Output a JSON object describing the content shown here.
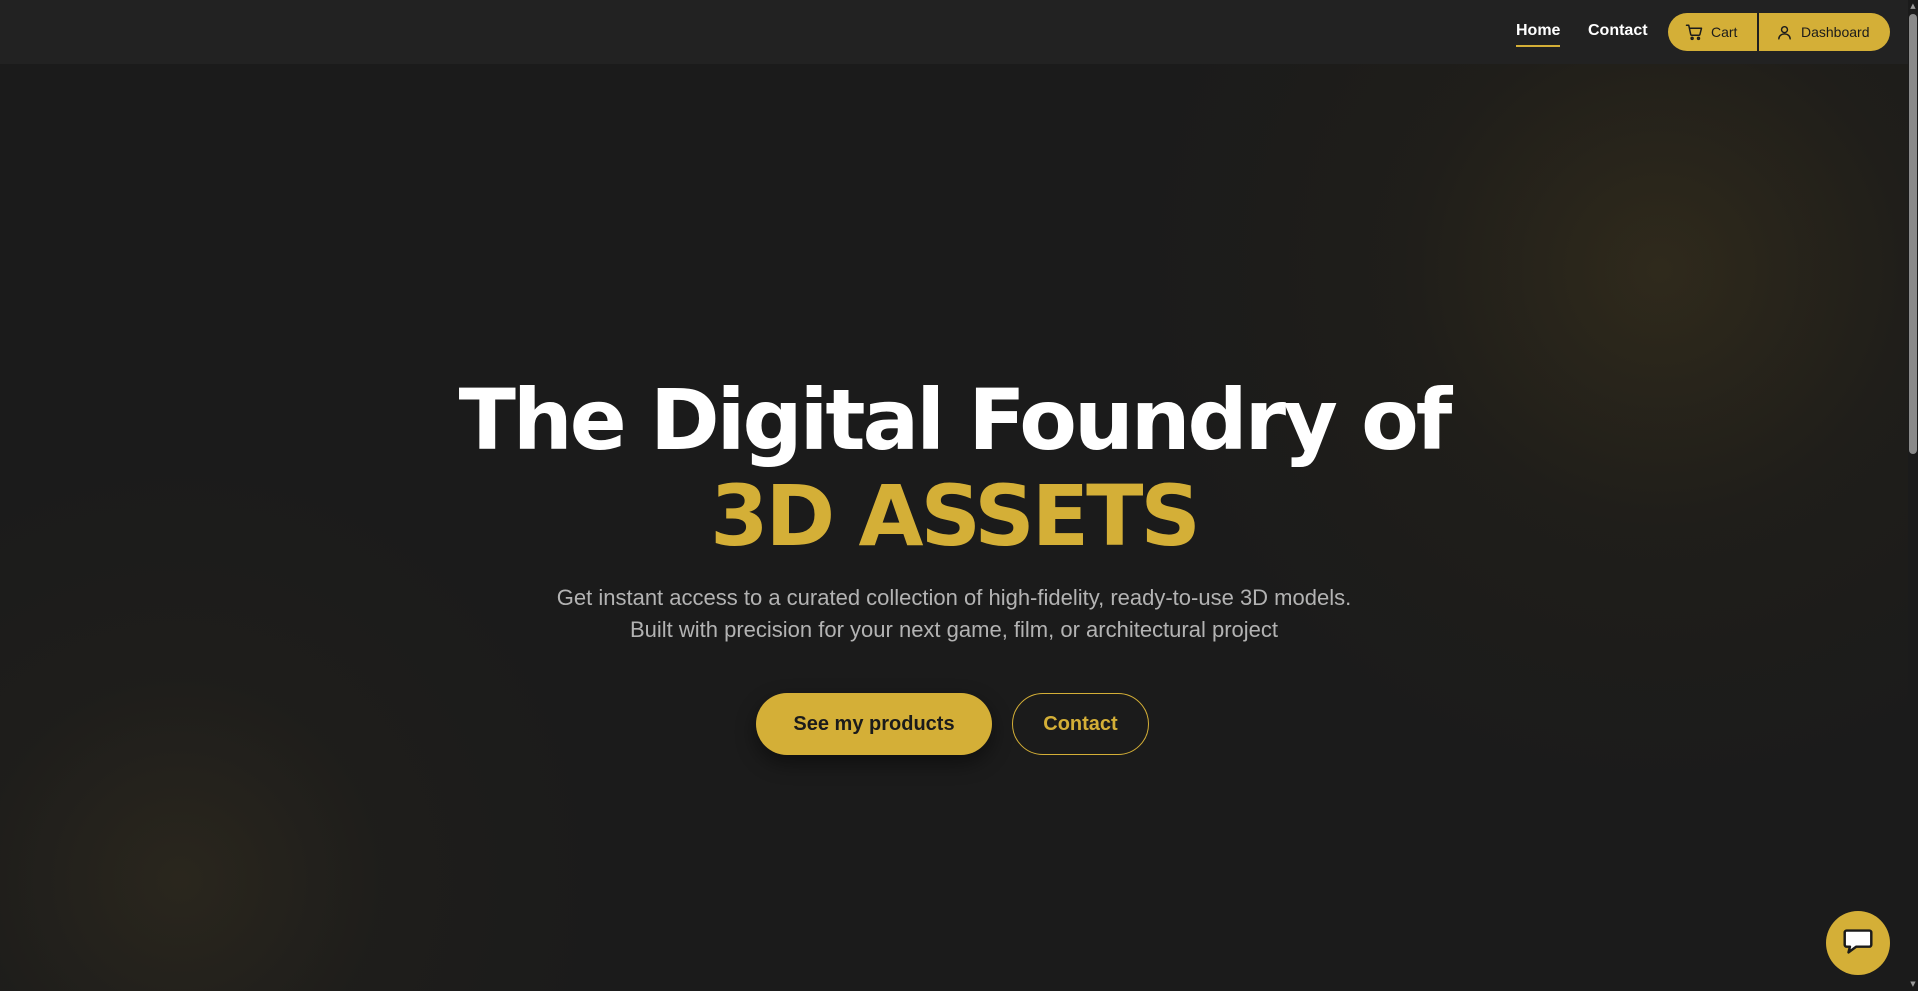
{
  "header": {
    "nav": [
      {
        "label": "Home",
        "active": true
      },
      {
        "label": "Contact",
        "active": false
      }
    ],
    "cart_label": "Cart",
    "dashboard_label": "Dashboard",
    "cart_icon": "cart-icon",
    "dashboard_icon": "user-icon"
  },
  "hero": {
    "title": "The Digital Foundry of",
    "title_accent": "3D ASSETS",
    "subtitle": "Get instant access to a curated collection of high-fidelity, ready-to-use 3D models. Built with precision for your next game, film, or architectural project",
    "primary_button": "See my products",
    "secondary_button": "Contact"
  },
  "chat": {
    "icon": "chat-icon"
  },
  "colors": {
    "accent": "#d4af37",
    "background": "#1b1b1b",
    "header": "#222222",
    "text": "#ffffff",
    "muted_text": "#b3b3b3"
  }
}
